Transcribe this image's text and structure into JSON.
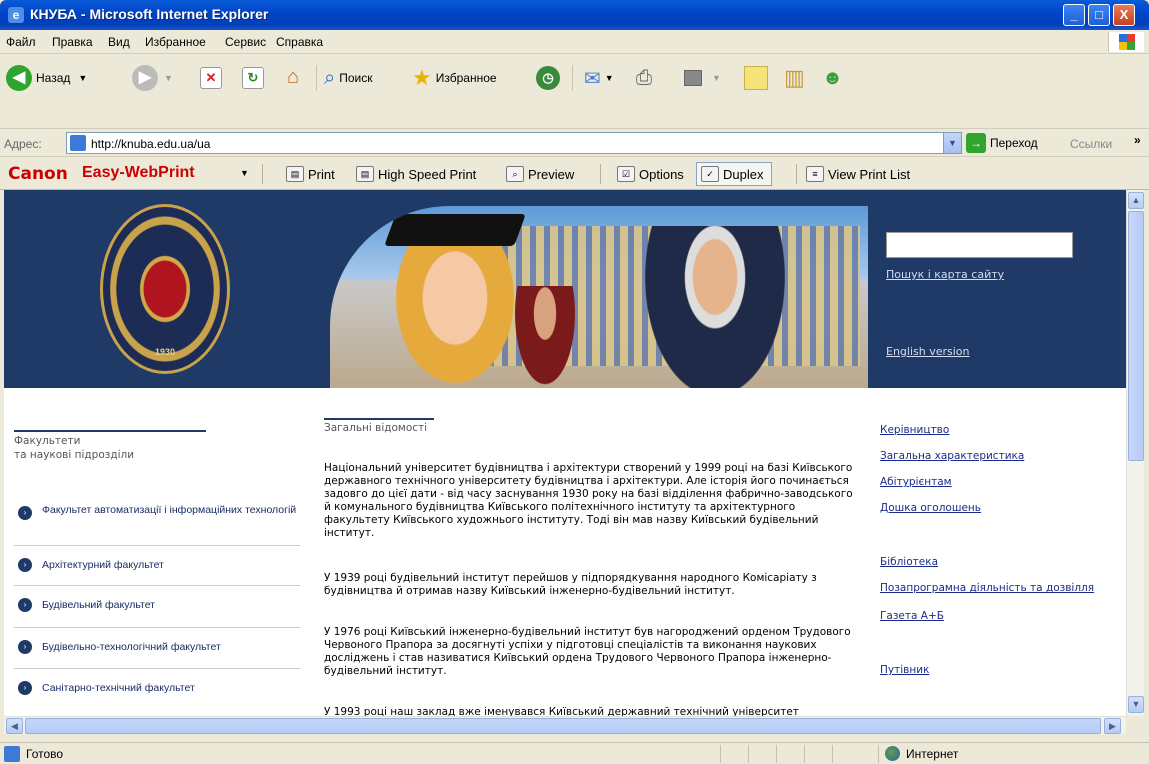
{
  "window": {
    "title": "КНУБА - Microsoft Internet Explorer",
    "min_glyph": "_",
    "max_glyph": "□",
    "close_glyph": "X"
  },
  "menu": [
    "Файл",
    "Правка",
    "Вид",
    "Избранное",
    "Сервис",
    "Справка"
  ],
  "toolbar": {
    "back_label": "Назад",
    "search_label": "Поиск",
    "favorites_label": "Избранное"
  },
  "address": {
    "label": "Адрес:",
    "url": "http://knuba.edu.ua/ua",
    "go_label": "Переход",
    "links_label": "Ссылки"
  },
  "canon": {
    "brand": "Canon",
    "product": "Easy-WebPrint",
    "print": "Print",
    "high_speed": "High Speed Print",
    "preview": "Preview",
    "options": "Options",
    "duplex": "Duplex",
    "view_list": "View Print List"
  },
  "banner": {
    "seal_year": "1930",
    "search_link": "Пошук і карта сайту",
    "english_link": "English version"
  },
  "left": {
    "heading": "Факультети\nта наукові підрозділи",
    "items": [
      "Факультет автоматизації і інформаційних технологій",
      "Архітектурний факультет",
      "Будівельний факультет",
      "Будівельно-технологічний факультет",
      "Санітарно-технічний факультет"
    ]
  },
  "main": {
    "heading": "Загальні відомості",
    "paragraphs": [
      "Національний університет будівництва і архітектури створений у 1999 році на базі Київського державного технічного університету будівництва і архітектури. Але історія його починається задовго до цієї дати - від часу заснування 1930 року на базі відділення фабрично-заводського й комунального будівництва Київського політехнічного інституту та архітектурного факультету Київського художнього інституту. Тоді він мав назву Київський будівельний інститут.",
      "У 1939 році будівельний інститут перейшов у підпорядкування народного Комісаріату з будівництва й отримав назву Київський інженерно-будівельний інститут.",
      "У 1976 році Київський інженерно-будівельний інститут був нагороджений орденом Трудового Червоного Прапора за досягнуті успіхи у підготовці спеціалістів та виконання наукових досліджень і став називатися Київський ордена Трудового Червоного Прапора інженерно-будівельний інститут.",
      "У 1993 році наш заклад вже іменувався Київський державний технічний університет"
    ]
  },
  "right": {
    "links": [
      "Керівництво",
      "Загальна характеристика",
      "Абітурієнтам",
      "Дошка оголошень",
      "Бібліотека",
      "Позапрограмна діяльність та дозвілля",
      "Газета А+Б",
      "Путівник"
    ]
  },
  "status": {
    "text": "Готово",
    "zone": "Интернет"
  },
  "colors": {
    "banner_bg": "#1f3a66",
    "link": "#1a2c8a",
    "canon_red": "#cc0000",
    "xp_title_blue": "#0046c8"
  }
}
